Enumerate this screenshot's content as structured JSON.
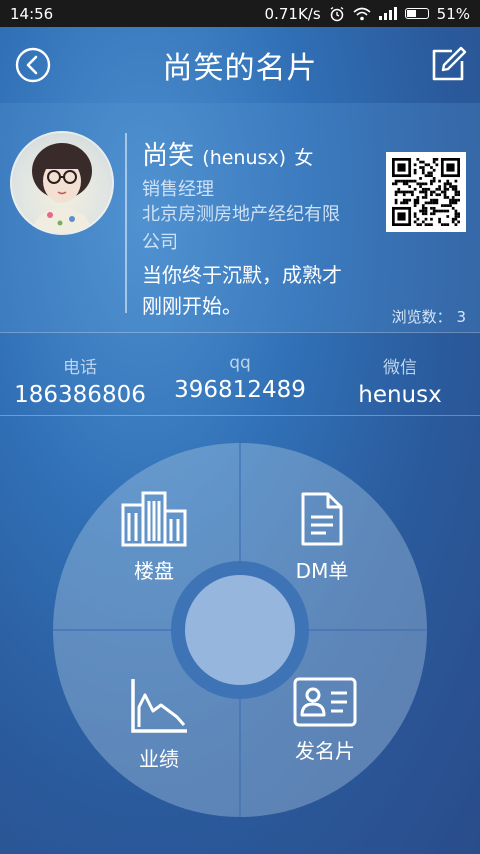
{
  "status_bar": {
    "time": "14:56",
    "speed": "0.71K/s",
    "battery": "51%",
    "battery_level": 0.51
  },
  "header": {
    "title": "尚笑的名片",
    "back_icon": "back-circle-icon",
    "edit_icon": "edit-icon"
  },
  "profile": {
    "name": "尚笑",
    "username": "(henusx)",
    "gender": "女",
    "position": "销售经理",
    "company": "北京房测房地产经纪有限公司",
    "motto": "当你终于沉默，成熟才刚刚开始。",
    "views_label": "浏览数：",
    "views": "3"
  },
  "contacts": [
    {
      "label": "电话",
      "value": "186386806"
    },
    {
      "label": "qq",
      "value": "396812489"
    },
    {
      "label": "微信",
      "value": "henusx"
    }
  ],
  "menu": [
    {
      "label": "楼盘",
      "icon": "building-icon"
    },
    {
      "label": "DM单",
      "icon": "document-icon"
    },
    {
      "label": "业绩",
      "icon": "chart-icon"
    },
    {
      "label": "发名片",
      "icon": "card-icon"
    }
  ],
  "colors": {
    "accent": "#3e73b5",
    "background": "#3170b6"
  }
}
